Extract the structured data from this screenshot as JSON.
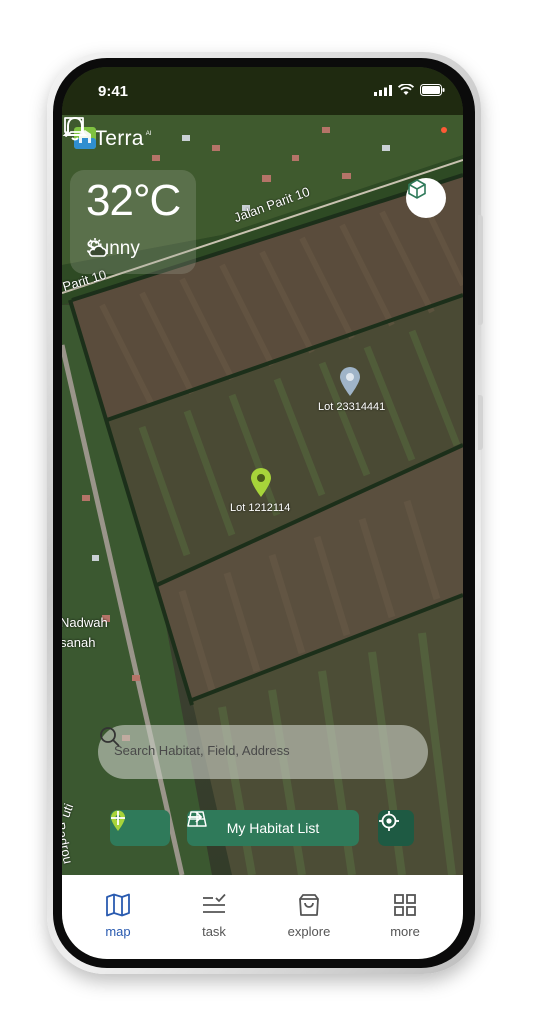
{
  "status_bar": {
    "time": "9:41"
  },
  "app": {
    "brand": "HiTerra",
    "brand_sup": "AI"
  },
  "weather": {
    "temperature": "32°C",
    "condition": "Sunny",
    "icon": "partly-cloudy-icon"
  },
  "map": {
    "road_labels": [
      "Jalan Parit 10",
      "Parit 10",
      "Jalan Badrou",
      "Nadwah",
      "sanah",
      "uti"
    ],
    "pins": [
      {
        "label": "Lot 23314441",
        "color": "#9fb4c8"
      },
      {
        "label": "Lot 1212114",
        "color": "#a7d43a"
      }
    ]
  },
  "search": {
    "placeholder": "Search Habitat, Field, Address"
  },
  "actions": {
    "habitat_list_label": "My Habitat List"
  },
  "nav": [
    {
      "label": "map",
      "icon": "map-icon",
      "active": true
    },
    {
      "label": "task",
      "icon": "task-checklist-icon",
      "active": false
    },
    {
      "label": "explore",
      "icon": "shopping-bag-icon",
      "active": false
    },
    {
      "label": "more",
      "icon": "grid-icon",
      "active": false
    }
  ],
  "colors": {
    "primary": "#2f7a5a",
    "active_nav": "#2a5bb0",
    "status_bar": "#1f2a10",
    "notification_dot": "#ff5a36"
  }
}
